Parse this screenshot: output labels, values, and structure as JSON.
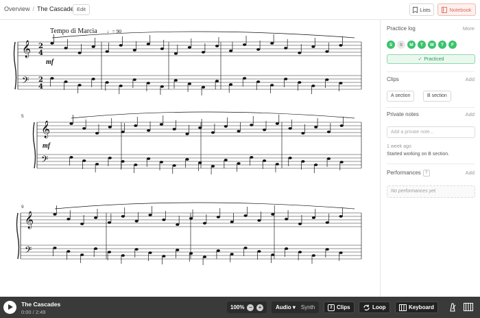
{
  "breadcrumb": {
    "root": "Overview",
    "separator": "/",
    "current": "The Cascades"
  },
  "topbar": {
    "edit_label": "Edit",
    "lists_label": "Lists",
    "notebook_label": "Notebook"
  },
  "score": {
    "tempo_text": "Tempo di Marcia",
    "tempo_value": "♩= 90",
    "dynamic_1": "mf",
    "dynamic_2": "mf",
    "measure_5": "5",
    "measure_9": "9",
    "time_sig_top": "2",
    "time_sig_bottom": "4"
  },
  "sidebar": {
    "practice_log": {
      "title": "Practice log",
      "more_label": "More",
      "days": [
        "S",
        "S",
        "M",
        "T",
        "W",
        "T",
        "F"
      ],
      "practiced_days": [
        true,
        false,
        true,
        true,
        true,
        true,
        true
      ],
      "practiced_label": "Practiced"
    },
    "clips": {
      "title": "Clips",
      "add_label": "Add",
      "items": [
        "A section",
        "B section"
      ]
    },
    "notes": {
      "title": "Private notes",
      "add_label": "Add",
      "placeholder": "Add a private note...",
      "time": "1 week ago",
      "text": "Started working on B section."
    },
    "performances": {
      "title": "Performances",
      "help": "?",
      "add_label": "Add",
      "empty_text": "No performances yet."
    }
  },
  "player": {
    "title": "The Cascades",
    "time": "0:00 / 2:49",
    "zoom": "100%",
    "zoom_minus": "−",
    "zoom_plus": "+",
    "audio_label": "Audio",
    "synth_label": "Synth",
    "clips_label": "Clips",
    "clips_count": "2",
    "loop_label": "Loop",
    "keyboard_label": "Keyboard"
  },
  "colors": {
    "accent_green": "#3ac26e",
    "notebook_red": "#e06a55",
    "player_bg": "#3a3a3a"
  }
}
